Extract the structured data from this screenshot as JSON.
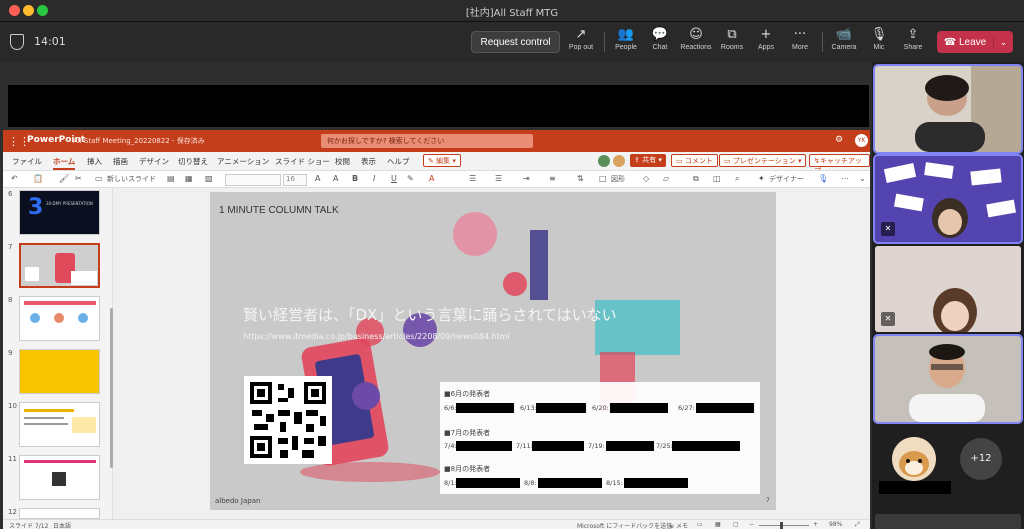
{
  "window": {
    "title": "[社内]All Staff MTG"
  },
  "meeting": {
    "timer": "14:01",
    "request_control": "Request control",
    "leave": "Leave",
    "leave_caret": "⌄"
  },
  "toolbar": [
    {
      "label": "Pop out",
      "icon": "↗"
    },
    {
      "label": "People",
      "icon": "👥"
    },
    {
      "label": "Chat",
      "icon": "💬"
    },
    {
      "label": "Reactions",
      "icon": "☺"
    },
    {
      "label": "Rooms",
      "icon": "⧉"
    },
    {
      "label": "Apps",
      "icon": "+"
    },
    {
      "label": "More",
      "icon": "···"
    },
    {
      "label": "Camera",
      "icon": "📹"
    },
    {
      "label": "Mic",
      "icon": "🎙"
    },
    {
      "label": "Share",
      "icon": "⇪"
    }
  ],
  "powerpoint": {
    "app_name": "PowerPoint",
    "doc_title": "All Staff Meeting_20220822 - 保存済み",
    "search_placeholder": "何かお探しですか? 検索してください",
    "user_initials": "YK",
    "menus": [
      "ファイル",
      "ホーム",
      "挿入",
      "描画",
      "デザイン",
      "切り替え",
      "アニメーション",
      "スライド ショー",
      "校閲",
      "表示",
      "ヘルプ"
    ],
    "edit_mode": "編集",
    "share": "共有",
    "comment": "コメント",
    "present": "プレゼンテーション",
    "catchup": "キャッチアップ",
    "ribbon": {
      "new_slide": "新しいスライド",
      "font_size": "16",
      "shapes": "図形",
      "designer": "デザイナー"
    },
    "thumbnails": [
      {
        "num": "6",
        "text": "3",
        "subtitle": "3X-DMY PRESENTATION"
      },
      {
        "num": "7",
        "text": ""
      },
      {
        "num": "8",
        "text": ""
      },
      {
        "num": "9",
        "text": ""
      },
      {
        "num": "10",
        "text": ""
      },
      {
        "num": "11",
        "text": ""
      },
      {
        "num": "12",
        "text": ""
      }
    ],
    "status": {
      "slide_pos": "スライド 7/12",
      "language": "日本語",
      "feedback": "Microsoft にフィードバックを送信",
      "notes": "メモ",
      "zoom": "98%"
    }
  },
  "slide": {
    "title": "1 MINUTE COLUMN TALK",
    "heading": "賢い経営者は、「DX」という言葉に踊らされてはいない",
    "url": "https://www.itmedia.co.jp/business/articles/2208/09/news084.html",
    "footer": "albedo Japan",
    "page": "7",
    "schedule": [
      {
        "label": "■6月の発表者",
        "dates": [
          "6/6:",
          "6/13:",
          "6/20:",
          "6/27:"
        ]
      },
      {
        "label": "■7月の発表者",
        "dates": [
          "7/4:",
          "7/11:",
          "7/19:",
          "7/25:"
        ]
      },
      {
        "label": "■8月の発表者",
        "dates": [
          "8/1:",
          "8/8:",
          "8/15:"
        ]
      }
    ]
  },
  "participants": {
    "more_count": "+12"
  },
  "colors": {
    "teams_bg": "#292929",
    "leave_red": "#c4314b",
    "ppt_brand": "#c43e1c",
    "active_speaker": "#7f85f5"
  }
}
